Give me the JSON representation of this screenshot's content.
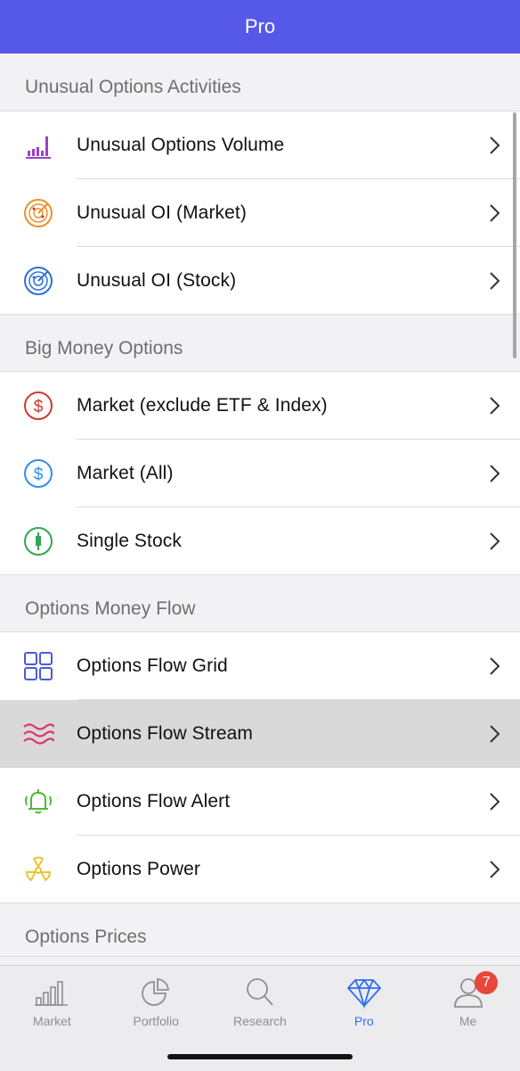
{
  "nav": {
    "title": "Pro"
  },
  "sections": [
    {
      "header": "Unusual Options Activities",
      "items": [
        {
          "label": "Unusual Options Volume",
          "icon": "volume-bars-icon"
        },
        {
          "label": "Unusual OI (Market)",
          "icon": "radar-orange-icon"
        },
        {
          "label": "Unusual OI (Stock)",
          "icon": "radar-blue-icon"
        }
      ]
    },
    {
      "header": "Big Money Options",
      "items": [
        {
          "label": "Market (exclude ETF & Index)",
          "icon": "dollar-red-icon"
        },
        {
          "label": "Market (All)",
          "icon": "dollar-blue-icon"
        },
        {
          "label": "Single Stock",
          "icon": "candlestick-green-icon"
        }
      ]
    },
    {
      "header": "Options Money Flow",
      "items": [
        {
          "label": "Options Flow Grid",
          "icon": "grid-icon"
        },
        {
          "label": "Options Flow Stream",
          "icon": "waves-icon",
          "highlighted": true
        },
        {
          "label": "Options Flow Alert",
          "icon": "bell-icon"
        },
        {
          "label": "Options Power",
          "icon": "radiation-icon"
        }
      ]
    },
    {
      "header": "Options Prices"
    }
  ],
  "tabbar": {
    "tabs": [
      {
        "label": "Market",
        "icon": "bar-chart-icon"
      },
      {
        "label": "Portfolio",
        "icon": "pie-chart-icon"
      },
      {
        "label": "Research",
        "icon": "search-icon"
      },
      {
        "label": "Pro",
        "icon": "diamond-icon",
        "active": true
      },
      {
        "label": "Me",
        "icon": "person-icon",
        "badge": "7"
      }
    ]
  },
  "colors": {
    "nav_bg": "#5658e8",
    "active_tab": "#2f6ff0",
    "badge": "#e8473a"
  }
}
